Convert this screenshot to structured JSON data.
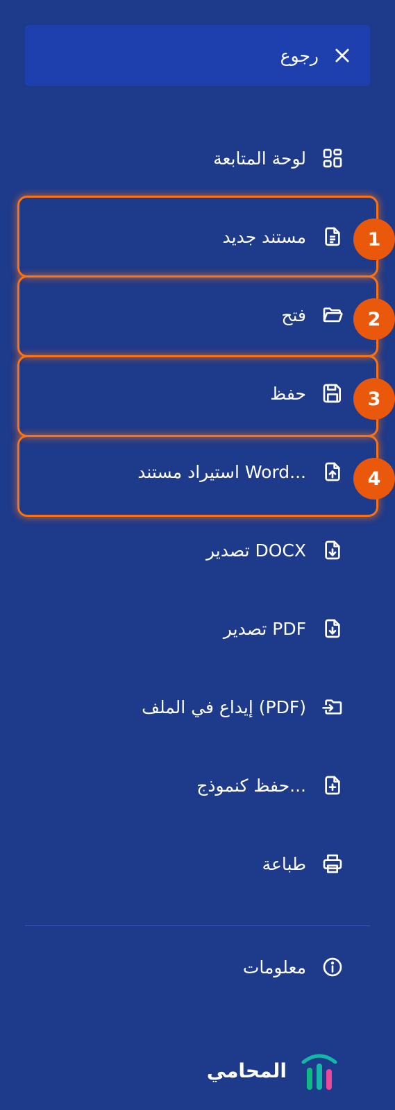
{
  "back": {
    "label": "رجوع",
    "icon": "close-icon"
  },
  "menu": [
    {
      "label": "لوحة المتابعة",
      "icon": "dashboard-icon"
    },
    {
      "label": "مستند جديد",
      "icon": "document-icon"
    },
    {
      "label": "فتح",
      "icon": "folder-open-icon"
    },
    {
      "label": "حفظ",
      "icon": "save-icon"
    },
    {
      "label": "استيراد مستند Word...",
      "icon": "file-upload-icon"
    },
    {
      "label": "تصدير DOCX",
      "icon": "file-download-icon"
    },
    {
      "label": "تصدير PDF",
      "icon": "file-download-icon"
    },
    {
      "label": "إيداع في الملف (PDF)",
      "icon": "file-export-icon"
    },
    {
      "label": "حفظ كنموذج...",
      "icon": "file-plus-icon"
    },
    {
      "label": "طباعة",
      "icon": "printer-icon"
    }
  ],
  "info": {
    "label": "معلومات",
    "icon": "info-icon"
  },
  "highlights": [
    {
      "number": "1"
    },
    {
      "number": "2"
    },
    {
      "number": "3"
    },
    {
      "number": "4"
    }
  ],
  "brand": {
    "name": "المحامي"
  },
  "colors": {
    "background": "#1e3a8a",
    "back_button": "#1e40af",
    "highlight": "#f97316",
    "badge": "#ea580c",
    "logo_teal": "#14b8a6",
    "logo_green": "#10b981",
    "logo_pink": "#ec4899"
  }
}
